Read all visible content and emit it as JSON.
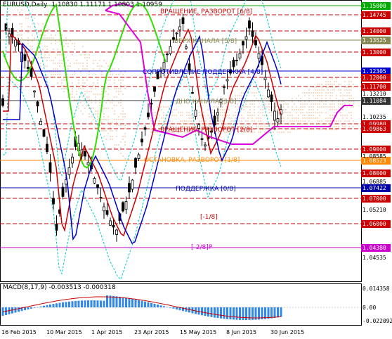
{
  "header": {
    "symbol": "EURUSD,Daily",
    "ohlc": "1.10830 1.11171 1.10803 1.10959"
  },
  "macd": {
    "label": "MACD(8,17,9) -0.003513 -0.000318",
    "scale_top": "0.014358",
    "scale_zero": "0.00",
    "scale_bottom": "-0.022092"
  },
  "price_axis": {
    "plain_ticks": [
      "1.13210",
      "1.10235",
      "1.08585",
      "1.06885",
      "1.05210",
      "1.04535"
    ],
    "colored_labels": [
      {
        "text": "1.15000",
        "bg": "#00aa00",
        "fg": "#ffffff"
      },
      {
        "text": "1.14745",
        "bg": "#cc0000",
        "fg": "#ffffff"
      },
      {
        "text": "1.14000",
        "bg": "#cc0000",
        "fg": "#ffffff"
      },
      {
        "text": "1.13525",
        "bg": "#888855",
        "fg": "#ffffff"
      },
      {
        "text": "1.13000",
        "bg": "#cc0000",
        "fg": "#ffffff"
      },
      {
        "text": "1.12305",
        "bg": "#0000cc",
        "fg": "#ffffff"
      },
      {
        "text": "1.12000",
        "bg": "#cc0000",
        "fg": "#ffffff"
      },
      {
        "text": "1.11700",
        "bg": "#cc0000",
        "fg": "#ffffff"
      },
      {
        "text": "1.11084",
        "bg": "#333333",
        "fg": "#ffffff"
      },
      {
        "text": "1.09980",
        "bg": "#cc0000",
        "fg": "#ffffff"
      },
      {
        "text": "1.09863",
        "bg": "#cc0000",
        "fg": "#ffffff"
      },
      {
        "text": "1.09000",
        "bg": "#cc0000",
        "fg": "#ffffff"
      },
      {
        "text": "1.08523",
        "bg": "#ff8800",
        "fg": "#ffffff"
      },
      {
        "text": "1.08000",
        "bg": "#cc0000",
        "fg": "#ffffff"
      },
      {
        "text": "1.07422",
        "bg": "#0000aa",
        "fg": "#ffffff"
      },
      {
        "text": "1.07000",
        "bg": "#cc0000",
        "fg": "#ffffff"
      },
      {
        "text": "1.06000",
        "bg": "#cc0000",
        "fg": "#ffffff"
      },
      {
        "text": "1.04380",
        "bg": "#cc00cc",
        "fg": "#ffffff"
      }
    ]
  },
  "murray_labels": [
    {
      "text": "ВРАЩЕНИЕ, РАЗВОРОТ [6/8]",
      "color": "#cc0000"
    },
    {
      "text": "ВЕРХ КАНАЛА [5/8]",
      "color": "#888855"
    },
    {
      "text": "СОПРОТИВЛЕНИЕ ПОДДЕРЖКА [4/8]",
      "color": "#0000cc"
    },
    {
      "text": "ДНО КАНАЛА [3/8]",
      "color": "#888855"
    },
    {
      "text": "ВРАЩЕНИЕ, РАЗВОРОТ [2/8]",
      "color": "#cc0000"
    },
    {
      "text": "ОСТАНОВКА, РАЗВОРОТ [1/8]",
      "color": "#ff8800"
    },
    {
      "text": "ПОДДЕРЖКА [0/8]",
      "color": "#0000aa"
    },
    {
      "text": "[-1/8]",
      "color": "#cc0000"
    },
    {
      "text": "[-2/8]P",
      "color": "#cc00cc"
    }
  ],
  "time_axis": [
    "16 Feb 2015",
    "10 Mar 2015",
    "1 Apr 2015",
    "23 Apr 2015",
    "15 May 2015",
    "8 Jun 2015",
    "30 Jun 2015"
  ],
  "colors": {
    "candle": "#000000",
    "fast_ma": "#cc0000",
    "slow_ma": "#0000cc",
    "momentum": "#33dd00",
    "envelope": "#dd00dd",
    "bands": "#00cccc",
    "cloud": "#dd8844",
    "macd_hist": "#3388ee",
    "macd_signal": "#cc0000"
  }
}
